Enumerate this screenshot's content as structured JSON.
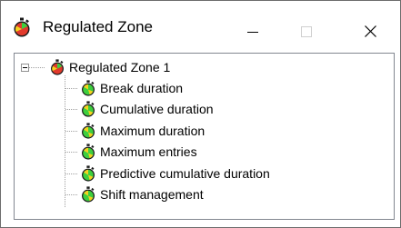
{
  "window": {
    "title": "Regulated Zone",
    "controls": {
      "minimize": "minimize",
      "maximize": "maximize",
      "close": "close"
    }
  },
  "tree": {
    "root": {
      "label": "Regulated Zone 1",
      "expanded": true,
      "icon": "stopwatch-red-icon",
      "children": [
        {
          "label": "Break duration",
          "icon": "stopwatch-green-icon"
        },
        {
          "label": "Cumulative duration",
          "icon": "stopwatch-green-icon"
        },
        {
          "label": "Maximum duration",
          "icon": "stopwatch-green-icon"
        },
        {
          "label": "Maximum entries",
          "icon": "stopwatch-green-icon"
        },
        {
          "label": "Predictive cumulative duration",
          "icon": "stopwatch-green-icon"
        },
        {
          "label": "Shift management",
          "icon": "stopwatch-green-icon"
        }
      ]
    }
  },
  "colors": {
    "stopwatch_red": "#e23a2c",
    "stopwatch_green": "#3ecf3e",
    "stopwatch_yellow": "#f4d21f",
    "stopwatch_black": "#1a1a1a"
  }
}
